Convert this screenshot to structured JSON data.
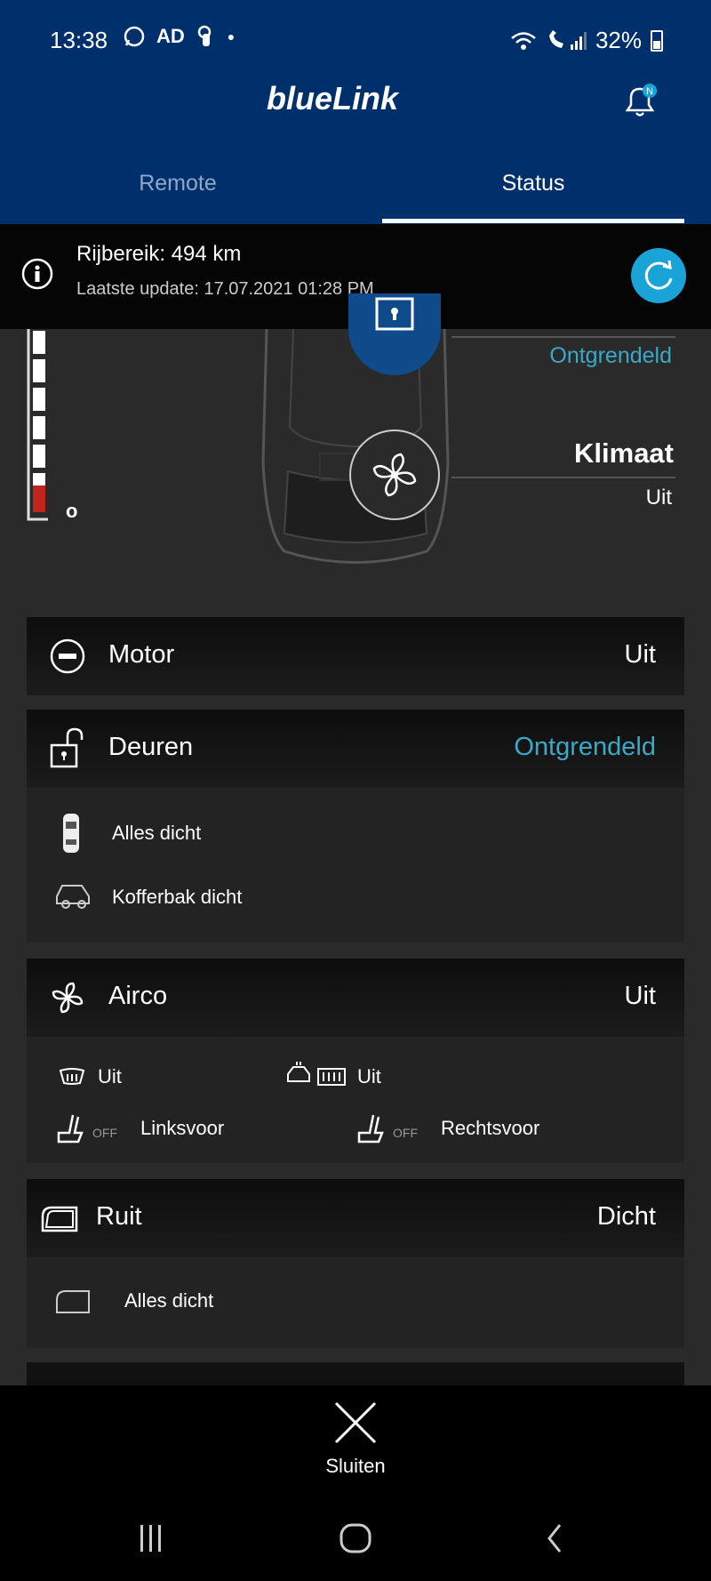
{
  "statusbar": {
    "time": "13:38",
    "apps": [
      "AD"
    ],
    "battery": "32%"
  },
  "app": {
    "logo": "blueLink"
  },
  "tabs": [
    {
      "label": "Remote"
    },
    {
      "label": "Status"
    }
  ],
  "info": {
    "range": "Rijbereik: 494 km",
    "update": "Laatste update: 17.07.2021 01:28 PM"
  },
  "car": {
    "gauge_zero": "o",
    "lock_status": "Ontgrendeld",
    "climate_label": "Klimaat",
    "climate_value": "Uit"
  },
  "cards": {
    "motor": {
      "title": "Motor",
      "value": "Uit"
    },
    "doors": {
      "title": "Deuren",
      "value": "Ontgrendeld",
      "all_closed": "Alles dicht",
      "trunk": "Kofferbak dicht"
    },
    "airco": {
      "title": "Airco",
      "front_defrost": "Uit",
      "rear_defrost": "Uit",
      "off_label": "OFF",
      "seat_left": "Linksvoor",
      "seat_right": "Rechtsvoor",
      "value": "Uit"
    },
    "window": {
      "title": "Ruit",
      "value": "Dicht",
      "all_closed": "Alles dicht"
    }
  },
  "bottom": {
    "close_label": "Sluiten"
  },
  "colors": {
    "header": "#00306b",
    "accent": "#3aa9c7",
    "refresh": "#1aa3d6"
  }
}
